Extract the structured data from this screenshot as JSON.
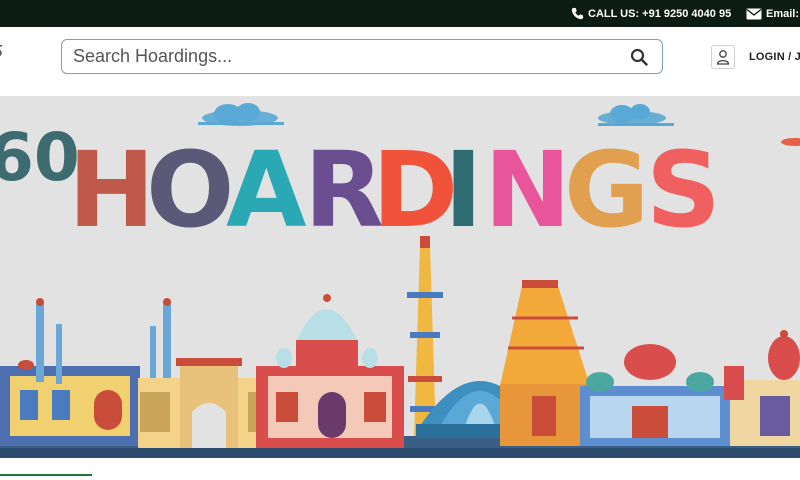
{
  "topbar": {
    "call_label": "CALL US: +91 9250 4040 95",
    "email_label": "Email:"
  },
  "search": {
    "placeholder": "Search Hoardings..."
  },
  "auth": {
    "login_label": "LOGIN / J"
  },
  "banner": {
    "prefix_text": "60",
    "title_letters": [
      "H",
      "O",
      "A",
      "R",
      "D",
      "I",
      "N",
      "G",
      "S"
    ],
    "title_colors": [
      "#bf5a4a",
      "#5a5a78",
      "#2aa9b5",
      "#6b4e8f",
      "#f0523a",
      "#2e6b73",
      "#e8559a",
      "#e0a050",
      "#f06060"
    ]
  },
  "colors": {
    "topbar_bg": "#0d1b15",
    "banner_bg": "#e2e2e2",
    "search_border": "#7aa2c4",
    "accent_green": "#1a7a3a"
  },
  "icons": {
    "phone": "phone-icon",
    "email": "envelope-icon",
    "search": "search-icon",
    "user": "user-icon"
  }
}
